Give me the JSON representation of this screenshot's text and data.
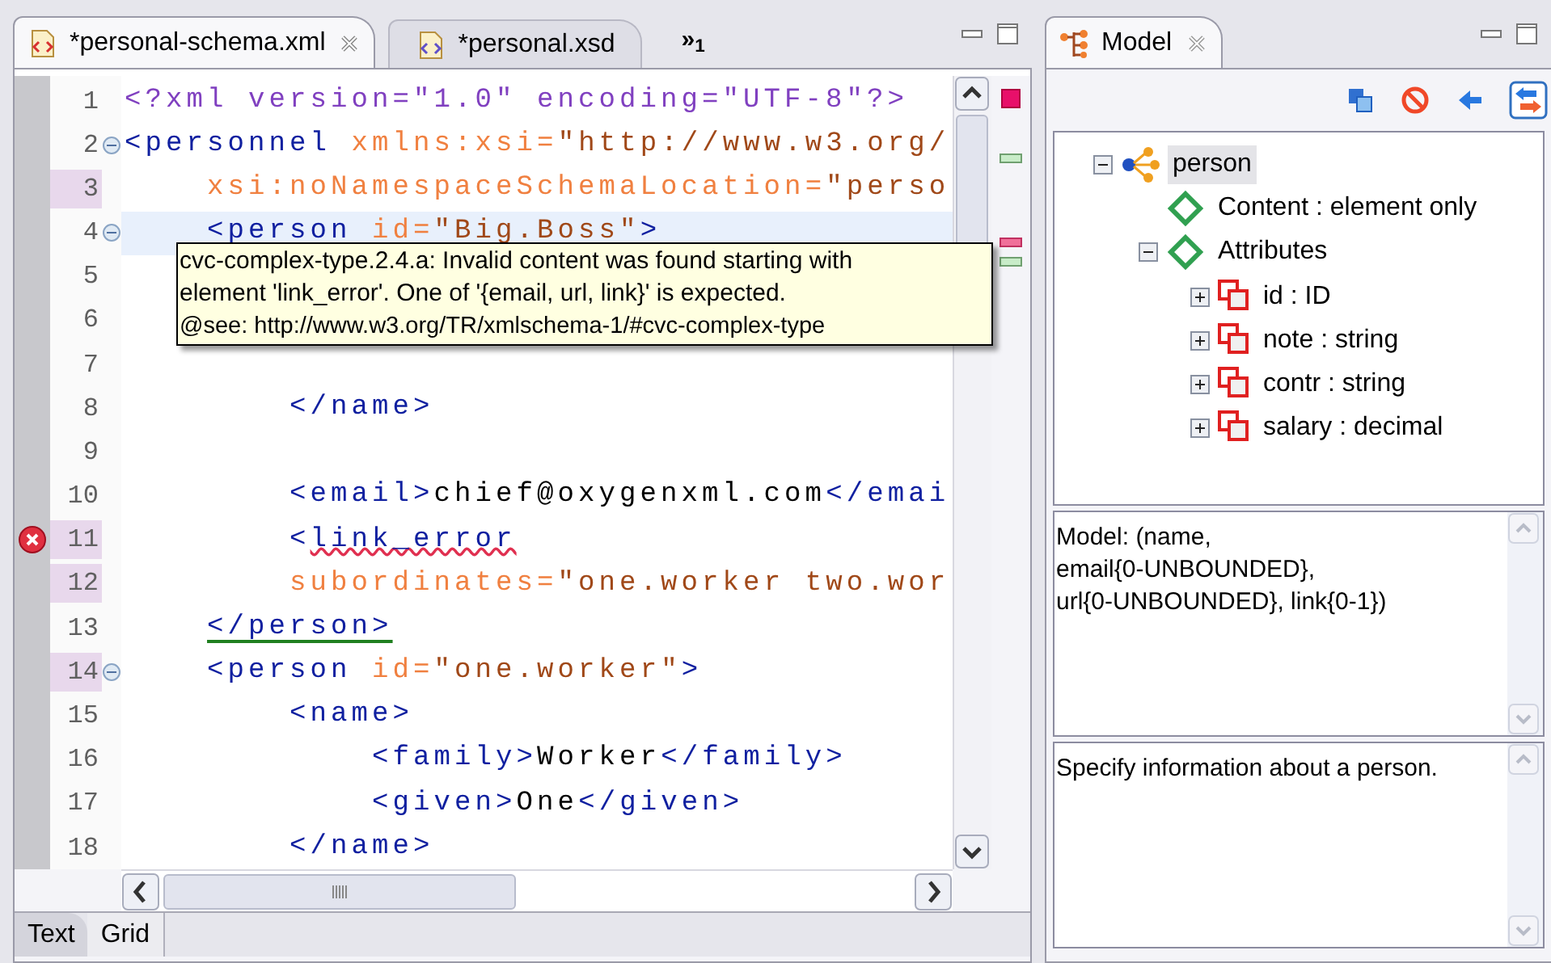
{
  "editor": {
    "tabs": [
      {
        "label": "*personal-schema.xml",
        "selected": true,
        "closable": true
      },
      {
        "label": "*personal.xsd",
        "selected": false,
        "closable": false
      }
    ],
    "overflow": {
      "symbol": "»",
      "count": "1"
    },
    "lines": [
      {
        "number": "1",
        "current": false,
        "flagged": false,
        "foldable": false,
        "error": false,
        "tokens": [
          {
            "kind": "decl",
            "text": "<?xml version=\"1.0\" encoding=\"UTF-8\"?>"
          }
        ]
      },
      {
        "number": "2",
        "current": false,
        "flagged": false,
        "foldable": true,
        "error": false,
        "tokens": [
          {
            "kind": "tag",
            "text": "<personnel "
          },
          {
            "kind": "attr",
            "text": "xmlns:xsi="
          },
          {
            "kind": "value",
            "text": "\"http://www.w3.org/"
          }
        ]
      },
      {
        "number": "3",
        "current": false,
        "flagged": true,
        "foldable": false,
        "error": false,
        "tokens": [
          {
            "kind": "attr",
            "text": "    xsi:noNamespaceSchemaLocation="
          },
          {
            "kind": "value",
            "text": "\"perso"
          }
        ]
      },
      {
        "number": "4",
        "current": true,
        "flagged": false,
        "foldable": true,
        "error": false,
        "tokens": [
          {
            "kind": "tag",
            "text": "    <person "
          },
          {
            "kind": "attr",
            "text": "id="
          },
          {
            "kind": "value",
            "text": "\"Big.Boss\""
          },
          {
            "kind": "tag",
            "text": ">"
          }
        ]
      },
      {
        "number": "5",
        "current": false,
        "flagged": false,
        "foldable": false,
        "error": false
      },
      {
        "number": "6",
        "current": false,
        "flagged": false,
        "foldable": false,
        "error": false
      },
      {
        "number": "7",
        "current": false,
        "flagged": false,
        "foldable": false,
        "error": false
      },
      {
        "number": "8",
        "current": false,
        "flagged": false,
        "foldable": false,
        "error": false,
        "tokens": [
          {
            "kind": "tag",
            "text": "        </name>"
          }
        ]
      },
      {
        "number": "9",
        "current": false,
        "flagged": false,
        "foldable": false,
        "error": false
      },
      {
        "number": "10",
        "current": false,
        "flagged": false,
        "foldable": false,
        "error": false,
        "tokens": [
          {
            "kind": "tag",
            "text": "        <email>"
          },
          {
            "kind": "text",
            "text": "chief@oxygenxml.com"
          },
          {
            "kind": "tag",
            "text": "</emai"
          }
        ]
      },
      {
        "number": "11",
        "current": false,
        "flagged": true,
        "foldable": false,
        "error": true,
        "tokens": [
          {
            "kind": "tag",
            "text": "        <"
          },
          {
            "kind": "tag",
            "text": "link_error",
            "squiggle": true
          }
        ]
      },
      {
        "number": "12",
        "current": false,
        "flagged": true,
        "foldable": false,
        "error": false,
        "tokens": [
          {
            "kind": "attr",
            "text": "        subordinates="
          },
          {
            "kind": "value",
            "text": "\"one.worker two.wor"
          }
        ]
      },
      {
        "number": "13",
        "current": false,
        "flagged": false,
        "foldable": false,
        "error": false,
        "tokens": [
          {
            "kind": "tag",
            "text": "    </person>",
            "matched": true
          }
        ]
      },
      {
        "number": "14",
        "current": false,
        "flagged": true,
        "foldable": true,
        "error": false,
        "tokens": [
          {
            "kind": "tag",
            "text": "    <person "
          },
          {
            "kind": "attr",
            "text": "id="
          },
          {
            "kind": "value",
            "text": "\"one.worker\""
          },
          {
            "kind": "tag",
            "text": ">"
          }
        ]
      },
      {
        "number": "15",
        "current": false,
        "flagged": false,
        "foldable": false,
        "error": false,
        "tokens": [
          {
            "kind": "tag",
            "text": "        <name>"
          }
        ]
      },
      {
        "number": "16",
        "current": false,
        "flagged": false,
        "foldable": false,
        "error": false,
        "tokens": [
          {
            "kind": "tag",
            "text": "            <family>"
          },
          {
            "kind": "text",
            "text": "Worker"
          },
          {
            "kind": "tag",
            "text": "</family>"
          }
        ]
      },
      {
        "number": "17",
        "current": false,
        "flagged": false,
        "foldable": false,
        "error": false,
        "tokens": [
          {
            "kind": "tag",
            "text": "            <given>"
          },
          {
            "kind": "text",
            "text": "One"
          },
          {
            "kind": "tag",
            "text": "</given>"
          }
        ]
      },
      {
        "number": "18",
        "current": false,
        "flagged": false,
        "foldable": false,
        "error": false,
        "tokens": [
          {
            "kind": "tag",
            "text": "        </name>"
          }
        ]
      }
    ],
    "overview_marks": [
      {
        "kind": "error"
      },
      {
        "kind": "match"
      },
      {
        "kind": "error"
      },
      {
        "kind": "match"
      }
    ],
    "tooltip": {
      "message": "cvc-complex-type.2.4.a: Invalid content was found starting with element 'link_error'. One of '{email, url, link}' is expected.",
      "see": "@see: http://www.w3.org/TR/xmlschema-1/#cvc-complex-type"
    },
    "bottom_tabs": [
      {
        "label": "Text",
        "selected": true
      },
      {
        "label": "Grid",
        "selected": false
      }
    ]
  },
  "model_view": {
    "tab": {
      "label": "Model",
      "selected": true
    },
    "tree": [
      {
        "label": "person",
        "kind": "element",
        "expanded": true,
        "selected": true,
        "children": [
          {
            "label": "Content : element only",
            "kind": "compositor"
          },
          {
            "label": "Attributes",
            "kind": "compositor",
            "expanded": true,
            "children": [
              {
                "label": "id : ID",
                "kind": "attribute",
                "expanded": false
              },
              {
                "label": "note : string",
                "kind": "attribute",
                "expanded": false
              },
              {
                "label": "contr : string",
                "kind": "attribute",
                "expanded": false
              },
              {
                "label": "salary : decimal",
                "kind": "attribute",
                "expanded": false
              }
            ]
          }
        ]
      }
    ],
    "model_text": [
      "Model: (name,",
      "email{0-UNBOUNDED},",
      "url{0-UNBOUNDED}, link{0-1})"
    ],
    "documentation": "Specify information about a person."
  }
}
